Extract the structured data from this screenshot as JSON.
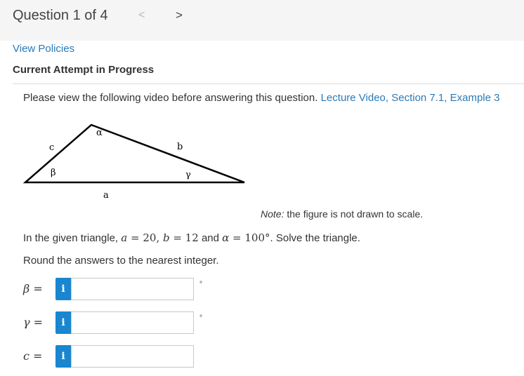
{
  "header": {
    "title": "Question 1 of 4",
    "prev_symbol": "<",
    "next_symbol": ">"
  },
  "links": {
    "view_policies": "View Policies"
  },
  "attempt": {
    "title": "Current Attempt in Progress"
  },
  "question": {
    "intro_text": "Please view the following video before answering this question.",
    "video_link": "Lecture Video, Section 7.1, Example 3",
    "figure_labels": {
      "alpha": "α",
      "c": "c",
      "b": "b",
      "beta": "β",
      "gamma": "γ",
      "a": "a"
    },
    "note_label": "Note:",
    "note_text": "the figure is not drawn to scale.",
    "problem_prefix": "In the given triangle,",
    "problem_a": "a",
    "problem_eq1": " = 20, ",
    "problem_b": "b",
    "problem_eq2": " = 12",
    "problem_and": "and",
    "problem_alpha": "α",
    "problem_eq3": " = 100°",
    "problem_suffix": ". Solve the triangle.",
    "round_text": "Round the answers to the nearest integer."
  },
  "answers": [
    {
      "variable": "β =",
      "info_label": "i",
      "value": "",
      "unit": "°"
    },
    {
      "variable": "γ =",
      "info_label": "i",
      "value": "",
      "unit": "°"
    },
    {
      "variable": "c =",
      "info_label": "i",
      "value": "",
      "unit": ""
    }
  ],
  "colors": {
    "link": "#2a7ab8",
    "info_button": "#1a86d0",
    "header_bg": "#f5f5f5"
  },
  "icons": {
    "prev": "chevron-left-icon",
    "next": "chevron-right-icon",
    "info": "info-icon"
  }
}
